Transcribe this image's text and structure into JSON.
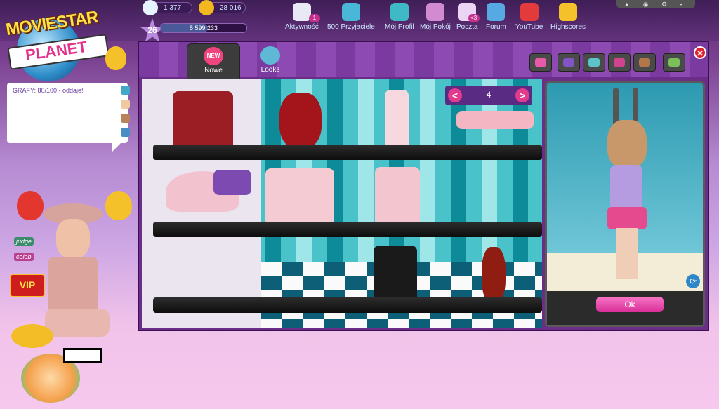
{
  "top": {
    "diamonds": "1 377",
    "coins": "28 016",
    "level": "26",
    "fame": "5 599 233",
    "fame_fill": 0.55,
    "window_controls": "▲ ◉ ⚙ ▪"
  },
  "logo": {
    "line1": "MOVIESTAR",
    "line2": "PLANET"
  },
  "nav": [
    {
      "label": "Aktywność",
      "icon": "activity-icon",
      "badge": "1"
    },
    {
      "label": "500 Przyjaciele",
      "icon": "friends-icon"
    },
    {
      "label": "Mój Profil",
      "icon": "profile-icon"
    },
    {
      "label": "Mój Pokój",
      "icon": "room-icon"
    },
    {
      "label": "Poczta",
      "icon": "mail-icon",
      "badge": "<3"
    },
    {
      "label": "Forum",
      "icon": "forum-icon"
    },
    {
      "label": "YouTube",
      "icon": "youtube-icon"
    },
    {
      "label": "Highscores",
      "icon": "trophy-icon"
    }
  ],
  "chat": {
    "message": "GRAFY: 80/100 - oddaje!"
  },
  "badges": {
    "judge": "judge",
    "celeb": "celeb",
    "vip": "VIP"
  },
  "shop": {
    "tabs": [
      {
        "label": "Nowe",
        "badge": "NEW"
      },
      {
        "label": "Looks"
      }
    ],
    "page": "4",
    "prev": "<",
    "next": ">",
    "close": "✕",
    "categories": [
      "tops-icon",
      "pants-icon",
      "shoes-icon",
      "accessories-icon",
      "hair-icon",
      "misc-icon"
    ]
  },
  "preview": {
    "ok": "Ok",
    "refresh": "⟳"
  },
  "colors": {
    "accent": "#d92e96",
    "frame": "#6a2e88",
    "nav_text": "#cfe9ff"
  }
}
